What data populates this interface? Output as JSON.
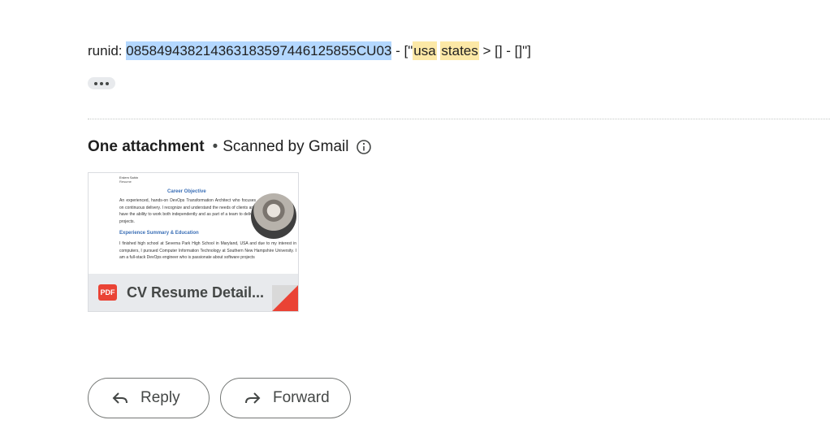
{
  "message": {
    "prefix": "runid: ",
    "runid": "085849438214363183597446125 85CU03",
    "runid_clean": "0858494382143631835974461258 5CU03",
    "runid_value": "0858494382143631835974461258 5CU03",
    "runid_text": "085849438214363183597446125855CU03",
    "runid_display": "085849438214363183597446125855CU03",
    "separator": " - [\"",
    "highlight1": "usa",
    "space": " ",
    "highlight2": "states",
    "suffix": " > [] - []\"]"
  },
  "attachments": {
    "title": "One attachment",
    "dot": "•",
    "scanned": "Scanned by Gmail",
    "file": {
      "name": "CV Resume Detail...",
      "type_badge": "PDF",
      "preview": {
        "name_line": "Erdem Sahin",
        "sub_line": "Resume",
        "heading1": "Career Objective",
        "para1": "An experienced, hands-on DevOps Transformation Architect who focuses on continuous delivery. I recognize and understand the needs of clients and have the ability to work both independently and as part of a team to deliver projects.",
        "heading2": "Experience Summary & Education",
        "para2": "I finished high school at Severna Park High School in Maryland, USA and due to my interest in computers, I pursued Computer Information Technology at Southern New Hampshire University. I am a full-stack DevOps engineer who is passionate about software projects"
      }
    }
  },
  "actions": {
    "reply": "Reply",
    "forward": "Forward"
  },
  "icons": {
    "more": "more-horiz-icon",
    "info": "info-icon",
    "pdf": "pdf-icon",
    "reply": "reply-icon",
    "forward": "forward-icon"
  },
  "colors": {
    "selection": "#b3d7fe",
    "highlight": "#fce8a6",
    "pdf_red": "#ea4335",
    "link_blue": "#3b6fb6"
  }
}
